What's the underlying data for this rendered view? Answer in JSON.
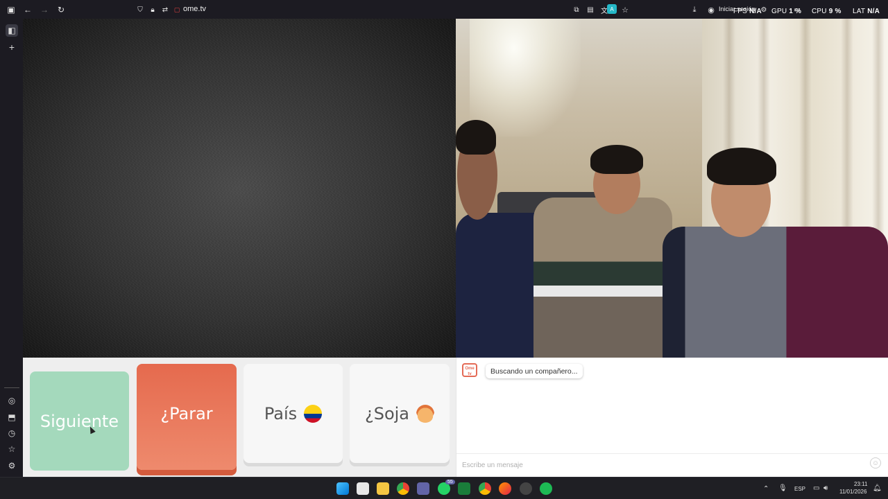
{
  "browser": {
    "url": "ome.tv",
    "signin_label": "Iniciar sesión",
    "perf": [
      {
        "label": "FPS",
        "value": "N/A"
      },
      {
        "label": "GPU",
        "value": "1 %"
      },
      {
        "label": "CPU",
        "value": "9 %"
      },
      {
        "label": "LAT",
        "value": "N/A"
      }
    ]
  },
  "controls": {
    "next_label": "Siguiente",
    "stop_label": "¿Parar",
    "country_label": "País",
    "gender_label": "¿Soja"
  },
  "chat": {
    "logo_text": "Ome tv",
    "status_message": "Buscando un compañero...",
    "input_placeholder": "Escribe un mensaje"
  },
  "taskbar": {
    "language": "ESP",
    "time": "23:11",
    "date": "11/01/2026",
    "badge_count": "55"
  },
  "colors": {
    "next_button": "#a4d9bc",
    "stop_button": "#e56a4e",
    "neutral_button": "#f7f7f7"
  }
}
